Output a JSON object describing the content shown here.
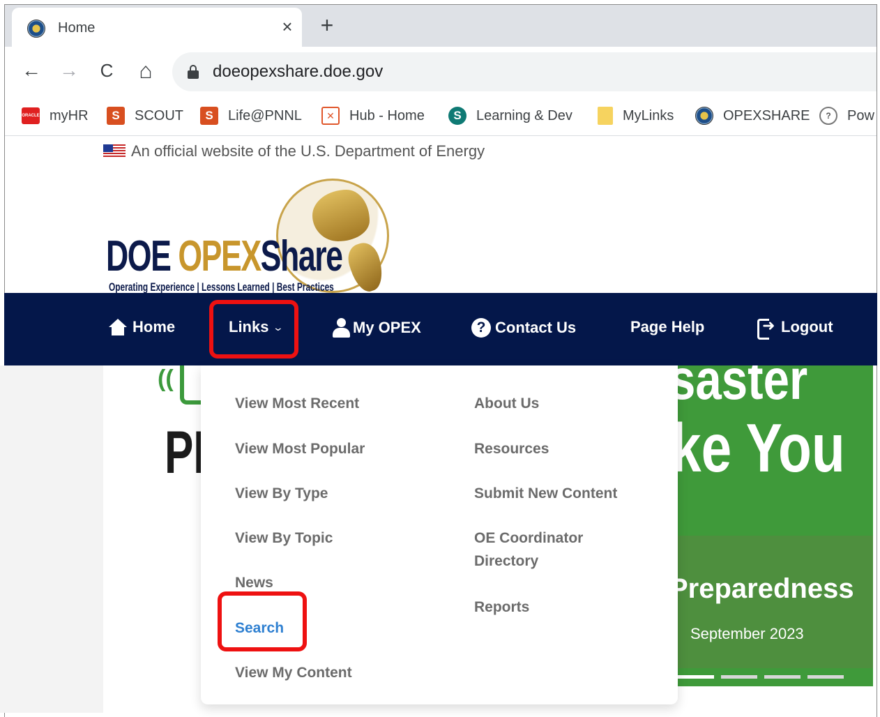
{
  "browser": {
    "tab_title": "Home",
    "tab_close": "×",
    "new_tab": "+",
    "url": "doeopexshare.doe.gov",
    "nav": {
      "back": "←",
      "forward": "→",
      "reload": "C",
      "home": "⌂"
    },
    "bookmarks": [
      {
        "label": "myHR",
        "icon": "oracle-icon",
        "glyph": "ORACLE"
      },
      {
        "label": "SCOUT",
        "icon": "sharepoint-s-icon",
        "glyph": "S"
      },
      {
        "label": "Life@PNNL",
        "icon": "sharepoint-s-icon",
        "glyph": "S"
      },
      {
        "label": "Hub - Home",
        "icon": "hub-icon",
        "glyph": "✕"
      },
      {
        "label": "Learning & Dev",
        "icon": "sharepoint-icon",
        "glyph": "S"
      },
      {
        "label": "MyLinks",
        "icon": "folder-icon",
        "glyph": ""
      },
      {
        "label": "OPEXSHARE",
        "icon": "doe-seal-icon",
        "glyph": ""
      },
      {
        "label": "Pow",
        "icon": "power-icon",
        "glyph": "?"
      }
    ]
  },
  "page": {
    "official_notice": "An official website of the U.S. Department of Energy",
    "logo": {
      "doe": "DOE ",
      "opex": "OPEX",
      "share": "Share",
      "tagline": "Operating Experience | Lessons Learned | Best Practices"
    },
    "nav": {
      "home": "Home",
      "links": "Links",
      "chevron": "⌄",
      "my_opex": "My OPEX",
      "contact_us": "Contact Us",
      "contact_glyph": "?",
      "page_help": "Page Help",
      "logout": "Logout"
    },
    "dropdown": {
      "left": [
        "View Most Recent",
        "View Most Popular",
        "View By Type",
        "View By Topic",
        "News",
        "Search",
        "View My Content"
      ],
      "right": [
        "About Us",
        "Resources",
        "Submit New Content",
        "OE Coordinator",
        "Directory",
        "Reports"
      ]
    },
    "background": {
      "left_wave": "((",
      "left_letters": "PI",
      "banner_line1": "saster",
      "banner_line2": "ke You",
      "banner_line3": "Preparedness",
      "banner_date": "September 2023"
    }
  },
  "colors": {
    "navbar": "#04174a",
    "highlight": "#ee1111",
    "active_link": "#2f80d1",
    "banner": "#3f9a3a"
  }
}
